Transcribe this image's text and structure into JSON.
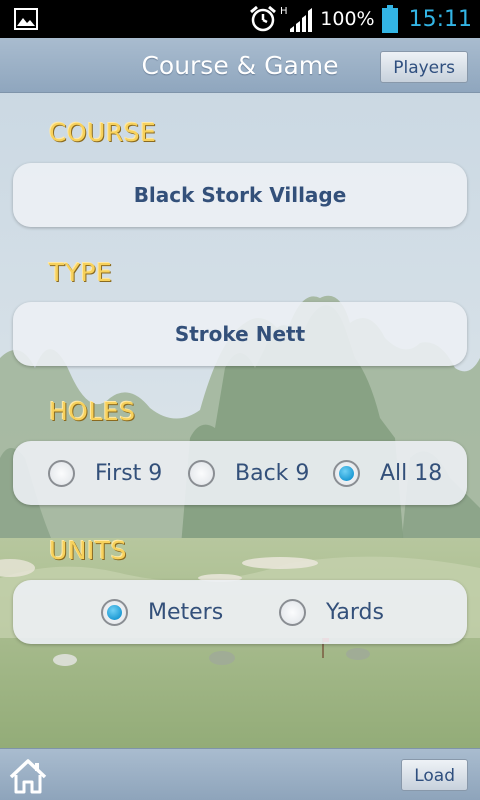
{
  "status_bar": {
    "network_type": "H",
    "battery": "100%",
    "time": "15:11"
  },
  "header": {
    "title": "Course & Game",
    "players_label": "Players"
  },
  "course": {
    "label": "COURSE",
    "value": "Black Stork Village"
  },
  "type": {
    "label": "TYPE",
    "value": "Stroke Nett"
  },
  "holes": {
    "label": "HOLES",
    "options": [
      {
        "label": "First 9",
        "checked": false
      },
      {
        "label": "Back 9",
        "checked": false
      },
      {
        "label": "All 18",
        "checked": true
      }
    ]
  },
  "units": {
    "label": "UNITS",
    "options": [
      {
        "label": "Meters",
        "checked": true
      },
      {
        "label": "Yards",
        "checked": false
      }
    ]
  },
  "bottom_bar": {
    "load_label": "Load"
  },
  "colors": {
    "accent": "#33b5e5",
    "label_gold": "#f7d15c",
    "text_blue": "#33507a",
    "radio_checked": "#1f9cd5"
  }
}
